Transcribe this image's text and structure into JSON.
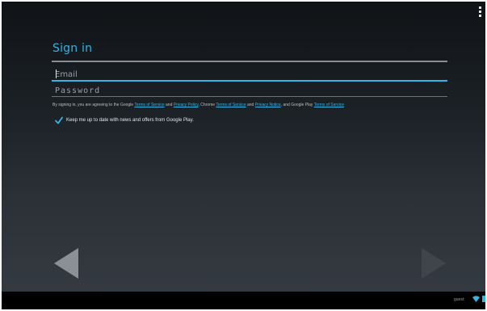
{
  "signin": {
    "title": "Sign in",
    "email_placeholder": "Email",
    "password_placeholder": "Password"
  },
  "legal": {
    "prefix": "By signing in, you are agreeing to the Google",
    "google_terms": "Terms of Service",
    "and1": "and",
    "google_privacy": "Privacy Policy",
    "chrome_prefix": ", Chrome",
    "chrome_terms": "Terms of Service",
    "and2": "and",
    "chrome_privacy": "Privacy Notice",
    "play_prefix": ", and Google Play",
    "play_terms": "Terms of Service"
  },
  "newsletter": {
    "label": "Keep me up to date with news and offers from Google Play.",
    "checked": true
  },
  "status": {
    "user": "guest"
  },
  "icons": {
    "menu": "overflow-menu-icon",
    "back": "back-arrow-icon",
    "next": "next-arrow-icon",
    "wifi": "wifi-icon",
    "battery": "battery-icon",
    "check": "checkmark-icon"
  },
  "colors": {
    "accent": "#33b5e5",
    "background_top": "#101316",
    "background_bottom": "#363c43",
    "text": "#e6e6e6",
    "arrow": "#8a9096",
    "arrow_disabled": "#3f454b"
  }
}
